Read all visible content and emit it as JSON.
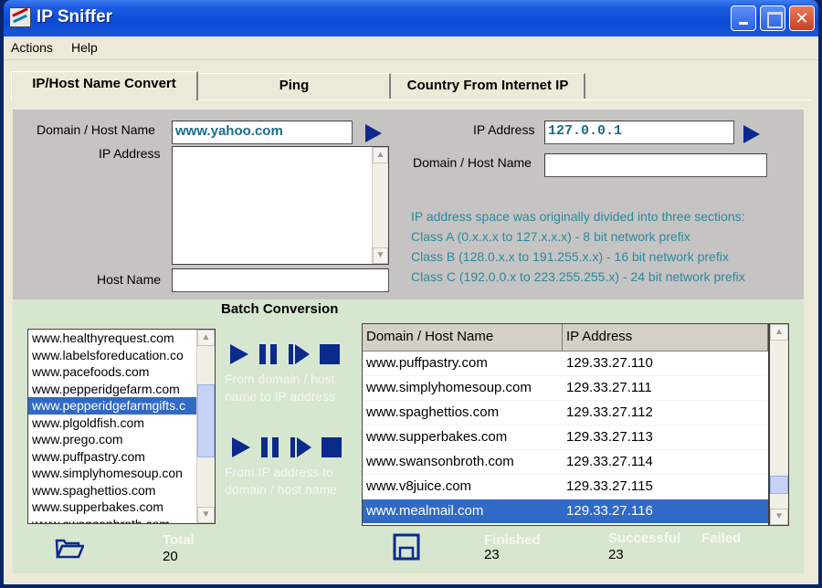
{
  "window": {
    "title": "IP Sniffer"
  },
  "menu": {
    "items": [
      "Actions",
      "Help"
    ]
  },
  "tabs": [
    "IP/Host Name Convert",
    "Ping",
    "Country From Internet IP"
  ],
  "left_form": {
    "domain_label": "Domain / Host Name",
    "domain_value": "www.yahoo.com",
    "ip_label": "IP Address",
    "host_label": "Host Name",
    "host_value": ""
  },
  "right_form": {
    "ip_label": "IP Address",
    "ip_value": "127.0.0.1",
    "domain_label": "Domain / Host Name",
    "domain_value": ""
  },
  "info_lines": [
    "IP address space was originally divided into three sections:",
    "Class A (0.x.x.x to 127.x.x.x) - 8 bit network prefix",
    "Class B (128.0.x.x to 191.255.x.x) - 16 bit network prefix",
    "Class C (192.0.0.x to 223.255.255.x) - 24 bit network prefix"
  ],
  "batch": {
    "title": "Batch Conversion",
    "list": [
      "www.healthyrequest.com",
      "www.labelsforeducation.co",
      "www.pacefoods.com",
      "www.pepperidgefarm.com",
      "www.pepperidgefarmgifts.c",
      "www.plgoldfish.com",
      "www.prego.com",
      "www.puffpastry.com",
      "www.simplyhomesoup.con",
      "www.spaghettios.com",
      "www.supperbakes.com",
      "www.swansonbroth.com"
    ],
    "selected_index": 4,
    "caption_to_ip": "From domain / host name to IP address",
    "caption_to_host": "From IP address to domain / host name",
    "columns": [
      "Domain / Host Name",
      "IP Address"
    ],
    "rows": [
      [
        "www.puffpastry.com",
        "129.33.27.110"
      ],
      [
        "www.simplyhomesoup.com",
        "129.33.27.111"
      ],
      [
        "www.spaghettios.com",
        "129.33.27.112"
      ],
      [
        "www.supperbakes.com",
        "129.33.27.113"
      ],
      [
        "www.swansonbroth.com",
        "129.33.27.114"
      ],
      [
        "www.v8juice.com",
        "129.33.27.115"
      ],
      [
        "www.mealmail.com",
        "129.33.27.116"
      ]
    ],
    "selected_row": 6
  },
  "stats": {
    "total_label": "Total",
    "total_value": "20",
    "finished_label": "Finished",
    "finished_value": "23",
    "successful_label": "Successful",
    "successful_value": "23",
    "failed_label": "Failed"
  }
}
